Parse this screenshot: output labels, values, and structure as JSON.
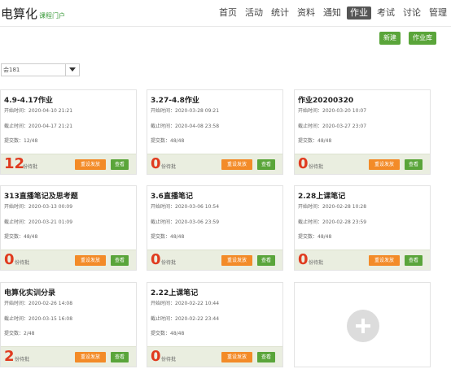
{
  "header": {
    "logo_main": "电算化",
    "logo_sub": "课程门户",
    "nav": [
      "首页",
      "活动",
      "统计",
      "资料",
      "通知",
      "作业",
      "考试",
      "讨论",
      "管理"
    ],
    "active_nav": "作业"
  },
  "toolbar": {
    "new_label": "新建",
    "library_label": "作业库"
  },
  "filter": {
    "class_value": "会181"
  },
  "buttons": {
    "resend": "重设发放",
    "view": "查看"
  },
  "pending_label": "份待批",
  "cards": [
    {
      "title": "4.9-4.17作业",
      "start": "开始时间：2020-04-10 21:21",
      "end": "截止时间：2020-04-17 21:21",
      "submitted": "提交数：12/48",
      "pending": "12"
    },
    {
      "title": "3.27-4.8作业",
      "start": "开始时间：2020-03-28 09:21",
      "end": "截止时间：2020-04-08 23:58",
      "submitted": "提交数：48/48",
      "pending": "0"
    },
    {
      "title": "作业20200320",
      "start": "开始时间：2020-03-20 10:07",
      "end": "截止时间：2020-03-27 23:07",
      "submitted": "提交数：48/48",
      "pending": "0"
    },
    {
      "title": "313直播笔记及思考题",
      "start": "开始时间：2020-03-13 00:09",
      "end": "截止时间：2020-03-21 01:09",
      "submitted": "提交数：48/48",
      "pending": "0"
    },
    {
      "title": "3.6直播笔记",
      "start": "开始时间：2020-03-06 10:54",
      "end": "截止时间：2020-03-06 23:59",
      "submitted": "提交数：48/48",
      "pending": "0"
    },
    {
      "title": "2.28上课笔记",
      "start": "开始时间：2020-02-28 10:28",
      "end": "截止时间：2020-02-28 23:59",
      "submitted": "提交数：48/48",
      "pending": "0"
    },
    {
      "title": "电算化实训分录",
      "start": "开始时间：2020-02-26 14:08",
      "end": "截止时间：2020-03-15 16:08",
      "submitted": "提交数：2/48",
      "pending": "2"
    },
    {
      "title": "2.22上课笔记",
      "start": "开始时间：2020-02-22 10:44",
      "end": "截止时间：2020-02-22 23:44",
      "submitted": "提交数：48/48",
      "pending": "0"
    }
  ]
}
